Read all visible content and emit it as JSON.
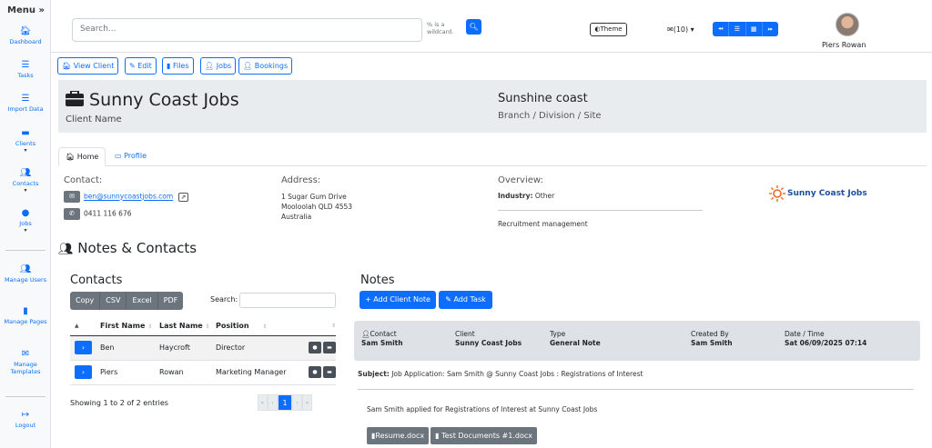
{
  "sidebar": {
    "menu_label": "Menu",
    "menu_toggle": "»",
    "items": [
      {
        "label": "Dashboard",
        "icon": "home-icon",
        "glyph": "🏠︎"
      },
      {
        "label": "Tasks",
        "icon": "list-icon",
        "glyph": "☰"
      },
      {
        "label": "Import Data",
        "icon": "list-icon",
        "glyph": "☰"
      },
      {
        "label": "Clients",
        "icon": "briefcase-icon",
        "glyph": "▬"
      },
      {
        "label": "Contacts",
        "icon": "users-icon",
        "glyph": "👥︎"
      },
      {
        "label": "Jobs",
        "icon": "user-circle-icon",
        "glyph": "●"
      },
      {
        "label": "Manage Users",
        "icon": "users-icon",
        "glyph": "👥︎"
      },
      {
        "label": "Manage Pages",
        "icon": "file-icon",
        "glyph": "▮"
      },
      {
        "label": "Manage Templates",
        "icon": "envelope-icon",
        "glyph": "✉"
      },
      {
        "label": "Logout",
        "icon": "logout-icon",
        "glyph": "↦"
      }
    ]
  },
  "topbar": {
    "search_placeholder": "Search...",
    "wildcard_line1": "% is a",
    "wildcard_line2": "wildcard.",
    "search_glyph": "🔍︎",
    "theme_label": "◐Theme",
    "mail_label": "✉(10) ▾",
    "nav_glyphs": [
      "⏪︎",
      "☰",
      "▦",
      "⏩︎"
    ],
    "user_name": "Piers Rowan"
  },
  "client_tabs": [
    "View Client",
    "Edit",
    "Files",
    "Jobs",
    "Bookings"
  ],
  "client_tab_glyphs": [
    "🏠︎",
    "✎",
    "▮",
    "👤︎",
    "👤︎"
  ],
  "client": {
    "name": "Sunny Coast Jobs",
    "name_label": "Client Name",
    "branch": "Sunshine coast",
    "branch_label": "Branch / Division / Site"
  },
  "detail_tabs": {
    "home": "Home",
    "profile": "Profile"
  },
  "contact": {
    "label": "Contact:",
    "email": "ben@sunnycoastjobs.com",
    "phone": "0411 116 676"
  },
  "address": {
    "label": "Address:",
    "line1": "1 Sugar Gum Drive",
    "line2": "Mooloolah  QLD  4553",
    "line3": "Australia"
  },
  "overview": {
    "label": "Overview:",
    "industry_label": "Industry:",
    "industry_value": "Other",
    "description": "Recruitment management"
  },
  "logo_text": "Sunny Coast Jobs",
  "notes_contacts_title": "Notes & Contacts",
  "contacts": {
    "title": "Contacts",
    "buttons": [
      "Copy",
      "CSV",
      "Excel",
      "PDF"
    ],
    "search_label": "Search:",
    "headers": [
      "First Name",
      "Last Name",
      "Position"
    ],
    "rows": [
      {
        "first": "Ben",
        "last": "Haycroft",
        "position": "Director"
      },
      {
        "first": "Piers",
        "last": "Rowan",
        "position": "Marketing Manager"
      }
    ],
    "info": "Showing 1 to 2 of 2 entries",
    "pager": [
      "«",
      "‹",
      "1",
      "›",
      "»"
    ]
  },
  "notes": {
    "title": "Notes",
    "add_note": "+ Add Client Note",
    "add_task": "✎ Add Task",
    "card": {
      "contact_label": "Contact",
      "contact_value": "Sam Smith",
      "client_label": "Client",
      "client_value": "Sunny Coast Jobs",
      "type_label": "Type",
      "type_value": "General Note",
      "created_label": "Created By",
      "created_value": "Sam Smith",
      "date_label": "Date / Time",
      "date_value": "Sat 06/09/2025 07:14"
    },
    "subject_label": "Subject:",
    "subject_text": "Job Application: Sam Smith @ Sunny Coast Jobs : Registrations of Interest",
    "body": "Sam Smith applied for Registrations of Interest at Sunny Coast Jobs",
    "attachments": [
      "Resume.docx",
      "Test Documents #1.docx"
    ]
  },
  "colors": {
    "primary": "#0d6efd",
    "secondary": "#6c757d",
    "logo_orange": "#f26522"
  }
}
